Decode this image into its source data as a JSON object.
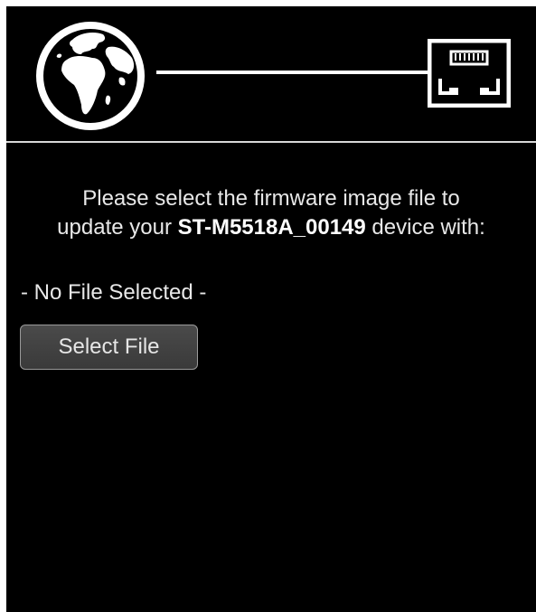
{
  "header": {
    "left_icon": "globe-icon",
    "right_icon": "ethernet-port-icon"
  },
  "message": {
    "line1": "Please select the firmware image file to",
    "line2_prefix": "update your ",
    "device_name": "ST-M5518A_00149",
    "line2_suffix": " device with:"
  },
  "file": {
    "status": "- No File Selected -",
    "select_label": "Select File"
  },
  "colors": {
    "background": "#000000",
    "text": "#e8e8e8",
    "button": "#3f3f3f",
    "page": "#ffffff"
  }
}
